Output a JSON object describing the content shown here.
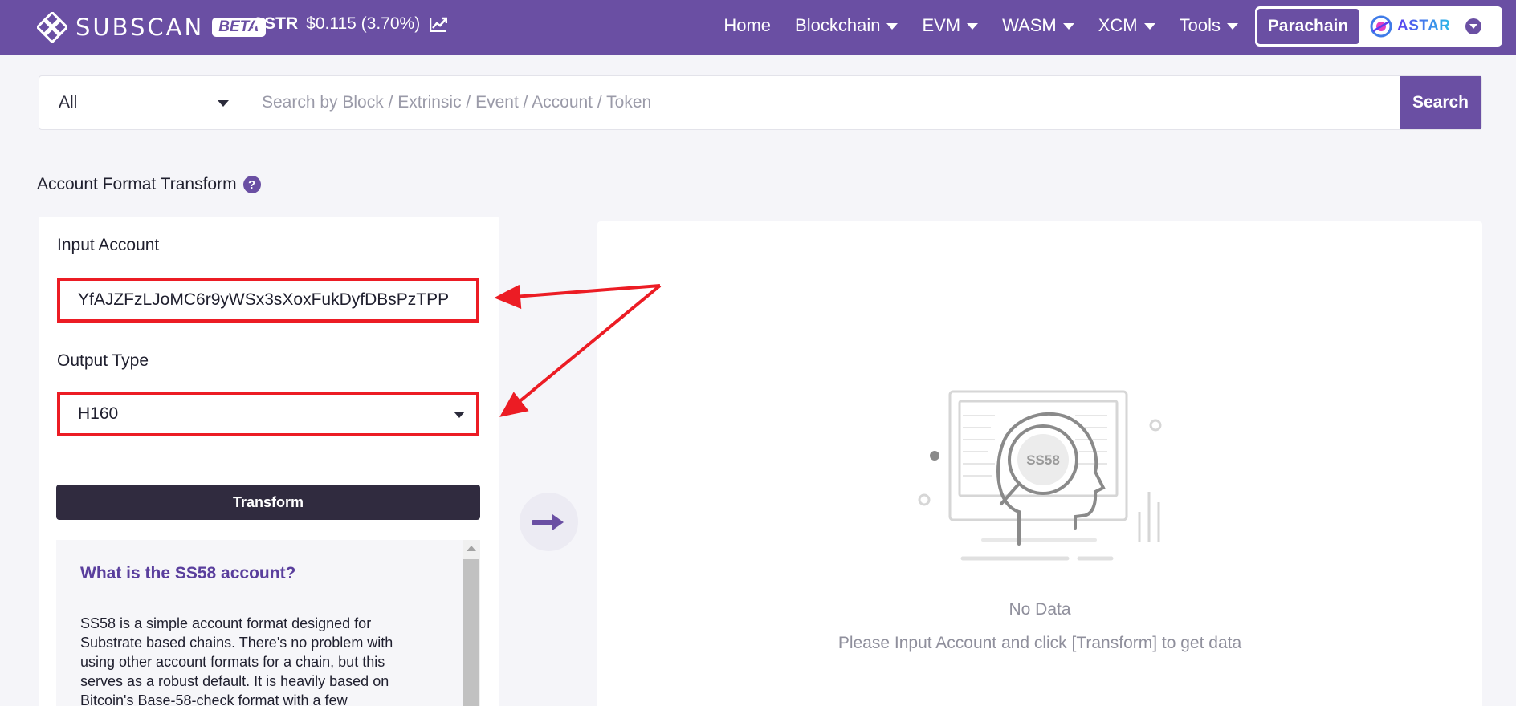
{
  "header": {
    "logo_text": "SUBSCAN",
    "beta_badge": "BETA",
    "token_symbol": "ASTR",
    "token_price": "$0.115 (3.70%)",
    "nav": [
      {
        "label": "Home",
        "has_dropdown": false
      },
      {
        "label": "Blockchain",
        "has_dropdown": true
      },
      {
        "label": "EVM",
        "has_dropdown": true
      },
      {
        "label": "WASM",
        "has_dropdown": true
      },
      {
        "label": "XCM",
        "has_dropdown": true
      },
      {
        "label": "Tools",
        "has_dropdown": true
      }
    ],
    "parachain_label": "Parachain",
    "network_name": "ASTAR"
  },
  "search": {
    "filter_value": "All",
    "placeholder": "Search by Block / Extrinsic / Event / Account / Token",
    "button_label": "Search"
  },
  "page": {
    "title": "Account Format Transform",
    "help_icon": "?"
  },
  "form": {
    "input_label": "Input Account",
    "input_value": "YfAJZFzLJoMC6r9yWSx3sXoxFukDyfDBsPzTPP",
    "output_label": "Output Type",
    "output_value": "H160",
    "transform_label": "Transform"
  },
  "info": {
    "title": "What is the SS58 account?",
    "text": "SS58 is a simple account format designed for Substrate based chains. There's no problem with using other account formats for a chain, but this serves as a robust default. It is heavily based on Bitcoin's Base-58-check format with a few"
  },
  "result": {
    "illustration_label": "SS58",
    "empty_title": "No Data",
    "empty_hint": "Please Input Account and click [Transform] to get data"
  },
  "colors": {
    "brand": "#6a4fa3",
    "annotation": "#ec1c24",
    "button_dark": "#302b3f"
  },
  "icons": [
    "logo-icon",
    "trend-chart-icon",
    "chevron-down-icon",
    "astar-logo-icon",
    "help-icon",
    "arrow-right-icon",
    "search-illustration-icon"
  ]
}
